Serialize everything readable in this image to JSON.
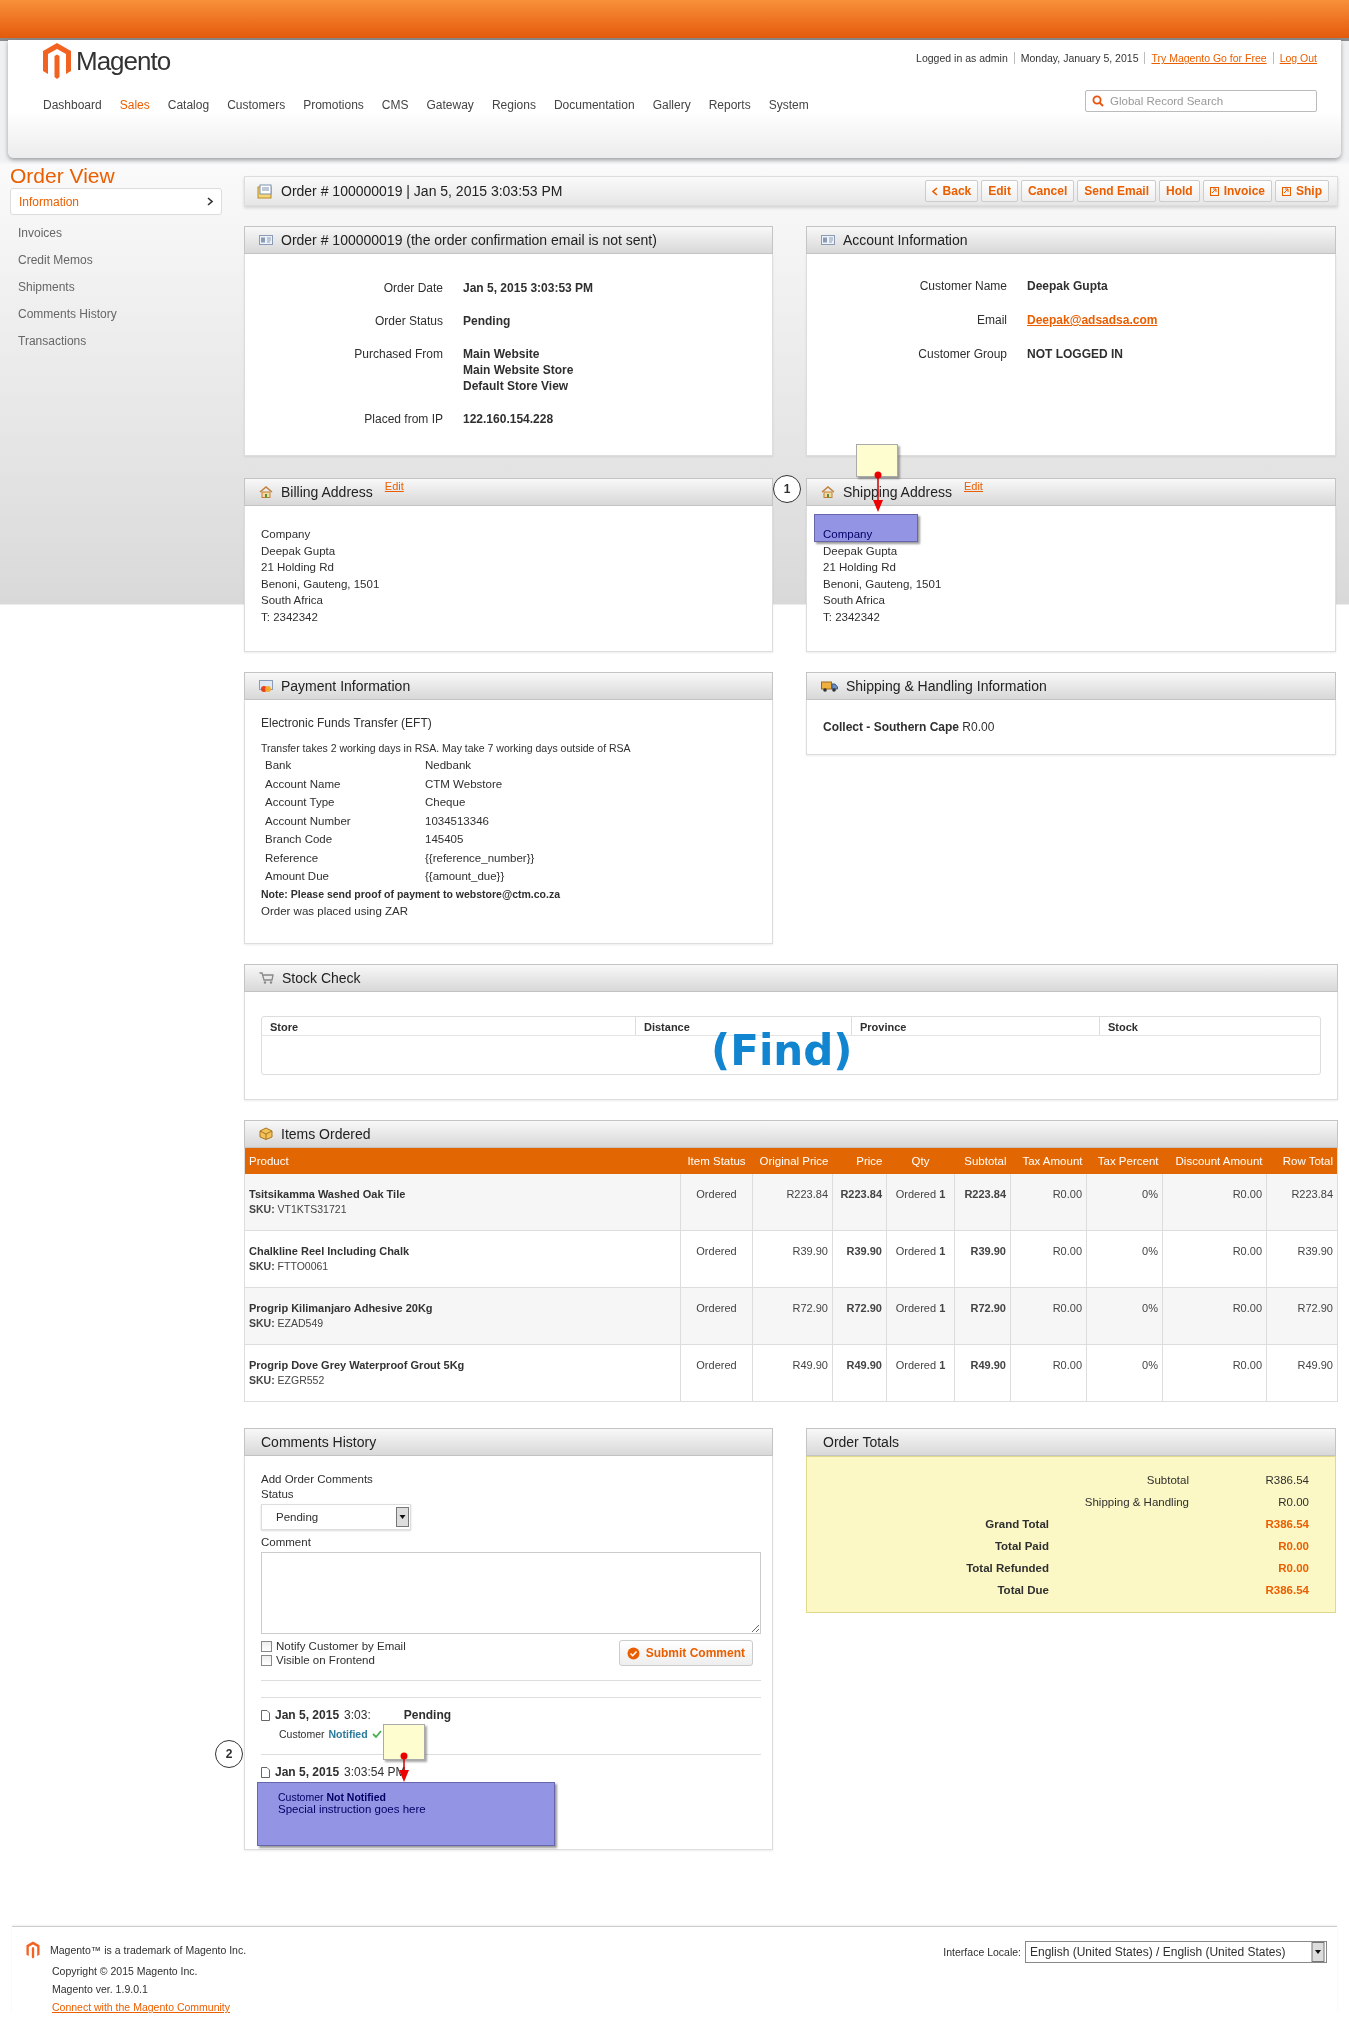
{
  "header": {
    "logo": "Magento",
    "user_info": "Logged in as admin",
    "date": "Monday, January 5, 2015",
    "links": [
      "Try Magento Go for Free",
      "Log Out"
    ],
    "nav": [
      {
        "label": "Dashboard",
        "selected": false
      },
      {
        "label": "Sales",
        "selected": true
      },
      {
        "label": "Catalog",
        "selected": false
      },
      {
        "label": "Customers",
        "selected": false
      },
      {
        "label": "Promotions",
        "selected": false
      },
      {
        "label": "CMS",
        "selected": false
      },
      {
        "label": "Gateway",
        "selected": false
      },
      {
        "label": "Regions",
        "selected": false
      },
      {
        "label": "Documentation",
        "selected": false
      },
      {
        "label": "Gallery",
        "selected": false
      },
      {
        "label": "Reports",
        "selected": false
      },
      {
        "label": "System",
        "selected": false
      }
    ],
    "search": {
      "placeholder": "Global Record Search"
    }
  },
  "sidebar": {
    "title": "Order View",
    "items": [
      {
        "label": "Information",
        "selected": true
      },
      {
        "label": "Invoices",
        "selected": false
      },
      {
        "label": "Credit Memos",
        "selected": false
      },
      {
        "label": "Shipments",
        "selected": false
      },
      {
        "label": "Comments History",
        "selected": false
      },
      {
        "label": "Transactions",
        "selected": false
      }
    ]
  },
  "title_bar": {
    "title": "Order # 100000019 | Jan 5, 2015 3:03:53 PM",
    "buttons": [
      {
        "label": "Back",
        "kind": "back"
      },
      {
        "label": "Edit",
        "kind": "plain"
      },
      {
        "label": "Cancel",
        "kind": "plain"
      },
      {
        "label": "Send Email",
        "kind": "plain"
      },
      {
        "label": "Hold",
        "kind": "plain"
      },
      {
        "label": "Invoice",
        "kind": "doc"
      },
      {
        "label": "Ship",
        "kind": "doc"
      }
    ]
  },
  "order_info": {
    "title": "Order # 100000019 (the order confirmation email is not sent)",
    "fields": [
      {
        "label": "Order Date",
        "lines": [
          "Jan 5, 2015 3:03:53 PM"
        ]
      },
      {
        "label": "Order Status",
        "lines": [
          "Pending"
        ]
      },
      {
        "label": "Purchased From",
        "lines": [
          "Main Website",
          "Main Website Store",
          "Default Store View"
        ]
      },
      {
        "label": "Placed from IP",
        "lines": [
          "122.160.154.228"
        ]
      }
    ]
  },
  "account_info": {
    "title": "Account Information",
    "fields": [
      {
        "label": "Customer Name",
        "value": "Deepak Gupta",
        "kind": "text"
      },
      {
        "label": "Email",
        "value": "Deepak@adsadsa.com",
        "kind": "link"
      },
      {
        "label": "Customer Group",
        "value": "NOT LOGGED IN",
        "kind": "text"
      }
    ]
  },
  "billing_address": {
    "title": "Billing Address",
    "edit": "Edit",
    "lines": [
      "Company",
      "Deepak Gupta",
      "21 Holding Rd",
      "Benoni, Gauteng, 1501",
      "South Africa",
      "T: 2342342"
    ]
  },
  "shipping_address": {
    "title": "Shipping Address",
    "edit": "Edit",
    "lines": [
      "Deepak Gupta",
      "21 Holding Rd",
      "Benoni, Gauteng, 1501",
      "South Africa",
      "T: 2342342"
    ],
    "annotation": {
      "number": "1",
      "overlay_text": "Company"
    }
  },
  "payment": {
    "title": "Payment Information",
    "method": "Electronic Funds Transfer (EFT)",
    "note": "Transfer takes 2 working days in RSA. May take 7 working days outside of RSA",
    "details": [
      {
        "label": "Bank",
        "value": "Nedbank"
      },
      {
        "label": "Account Name",
        "value": "CTM Webstore"
      },
      {
        "label": "Account Type",
        "value": "Cheque"
      },
      {
        "label": "Account Number",
        "value": "1034513346"
      },
      {
        "label": "Branch Code",
        "value": "145405"
      },
      {
        "label": "Reference",
        "value": "{{reference_number}}"
      },
      {
        "label": "Amount Due",
        "value": "{{amount_due}}"
      }
    ],
    "proof_note": "Note: Please send proof of payment to webstore@ctm.co.za",
    "currency": "Order was placed using ZAR"
  },
  "shipping_info": {
    "title": "Shipping & Handling Information",
    "method": "**Collect - Southern Cape** R0.00"
  },
  "stock_check": {
    "title": "Stock Check",
    "columns": [
      "Store",
      "Distance",
      "Province",
      "Stock"
    ],
    "overlay_text": "(Find)"
  },
  "items": {
    "title": "Items Ordered",
    "columns": [
      "Product",
      "Item Status",
      "Original Price",
      "Price",
      "Qty",
      "Subtotal",
      "Tax Amount",
      "Tax Percent",
      "Discount Amount",
      "Row Total"
    ],
    "rows": [
      {
        "product": "Tsitsikamma Washed Oak Tile",
        "sku_label": "SKU:",
        "sku": "VT1KTS31721",
        "status": "Ordered",
        "original_price": "R223.84",
        "price": "R223.84",
        "qty_status": "Ordered",
        "qty": "1",
        "subtotal": "R223.84",
        "tax": "R0.00",
        "tax_percent": "0%",
        "discount": "R0.00",
        "row_total": "R223.84"
      },
      {
        "product": "Chalkline Reel Including Chalk",
        "sku_label": "SKU:",
        "sku": "FTTO0061",
        "status": "Ordered",
        "original_price": "R39.90",
        "price": "R39.90",
        "qty_status": "Ordered",
        "qty": "1",
        "subtotal": "R39.90",
        "tax": "R0.00",
        "tax_percent": "0%",
        "discount": "R0.00",
        "row_total": "R39.90"
      },
      {
        "product": "Progrip Kilimanjaro Adhesive 20Kg",
        "sku_label": "SKU:",
        "sku": "EZAD549",
        "status": "Ordered",
        "original_price": "R72.90",
        "price": "R72.90",
        "qty_status": "Ordered",
        "qty": "1",
        "subtotal": "R72.90",
        "tax": "R0.00",
        "tax_percent": "0%",
        "discount": "R0.00",
        "row_total": "R72.90"
      },
      {
        "product": "Progrip Dove Grey Waterproof Grout 5Kg",
        "sku_label": "SKU:",
        "sku": "EZGR552",
        "status": "Ordered",
        "original_price": "R49.90",
        "price": "R49.90",
        "qty_status": "Ordered",
        "qty": "1",
        "subtotal": "R49.90",
        "tax": "R0.00",
        "tax_percent": "0%",
        "discount": "R0.00",
        "row_total": "R49.90"
      }
    ]
  },
  "comments": {
    "title": "Comments History",
    "add_title": "Add Order Comments",
    "status_label": "Status",
    "status_value": "Pending",
    "comment_label": "Comment",
    "checkboxes": [
      {
        "label": "Notify Customer by Email",
        "checked": false
      },
      {
        "label": "Visible on Frontend",
        "checked": false
      }
    ],
    "submit": "Submit Comment",
    "entry": {
      "date": "Jan 5, 2015",
      "time": "3:03:",
      "status": "Pending",
      "customer": "Customer",
      "notified": "Notified"
    },
    "entry2": {
      "date": "Jan 5, 2015",
      "time": "3:03:54 PM"
    },
    "annotation": {
      "number": "2",
      "overlay_lines": [
        "Customer **Not Notified**",
        "Special instruction goes here"
      ]
    }
  },
  "totals": {
    "title": "Order Totals",
    "rows": [
      {
        "label": "Subtotal",
        "value": "R386.54",
        "kind": "normal"
      },
      {
        "label": "Shipping & Handling",
        "value": "R0.00",
        "kind": "normal"
      },
      {
        "label": "Grand Total",
        "value": "R386.54",
        "kind": "strong"
      },
      {
        "label": "Total Paid",
        "value": "R0.00",
        "kind": "strong"
      },
      {
        "label": "Total Refunded",
        "value": "R0.00",
        "kind": "strong"
      },
      {
        "label": "Total Due",
        "value": "R386.54",
        "kind": "strong"
      }
    ]
  },
  "footer": {
    "trademark": "Magento™ is a trademark of Magento Inc.",
    "copyright": "Copyright © 2015 Magento Inc.",
    "version": "Magento ver. 1.9.0.1",
    "community_link": "Connect with the Magento Community",
    "locale_label": "Interface Locale:",
    "locale_value": "English (United States) / English (United States)"
  }
}
